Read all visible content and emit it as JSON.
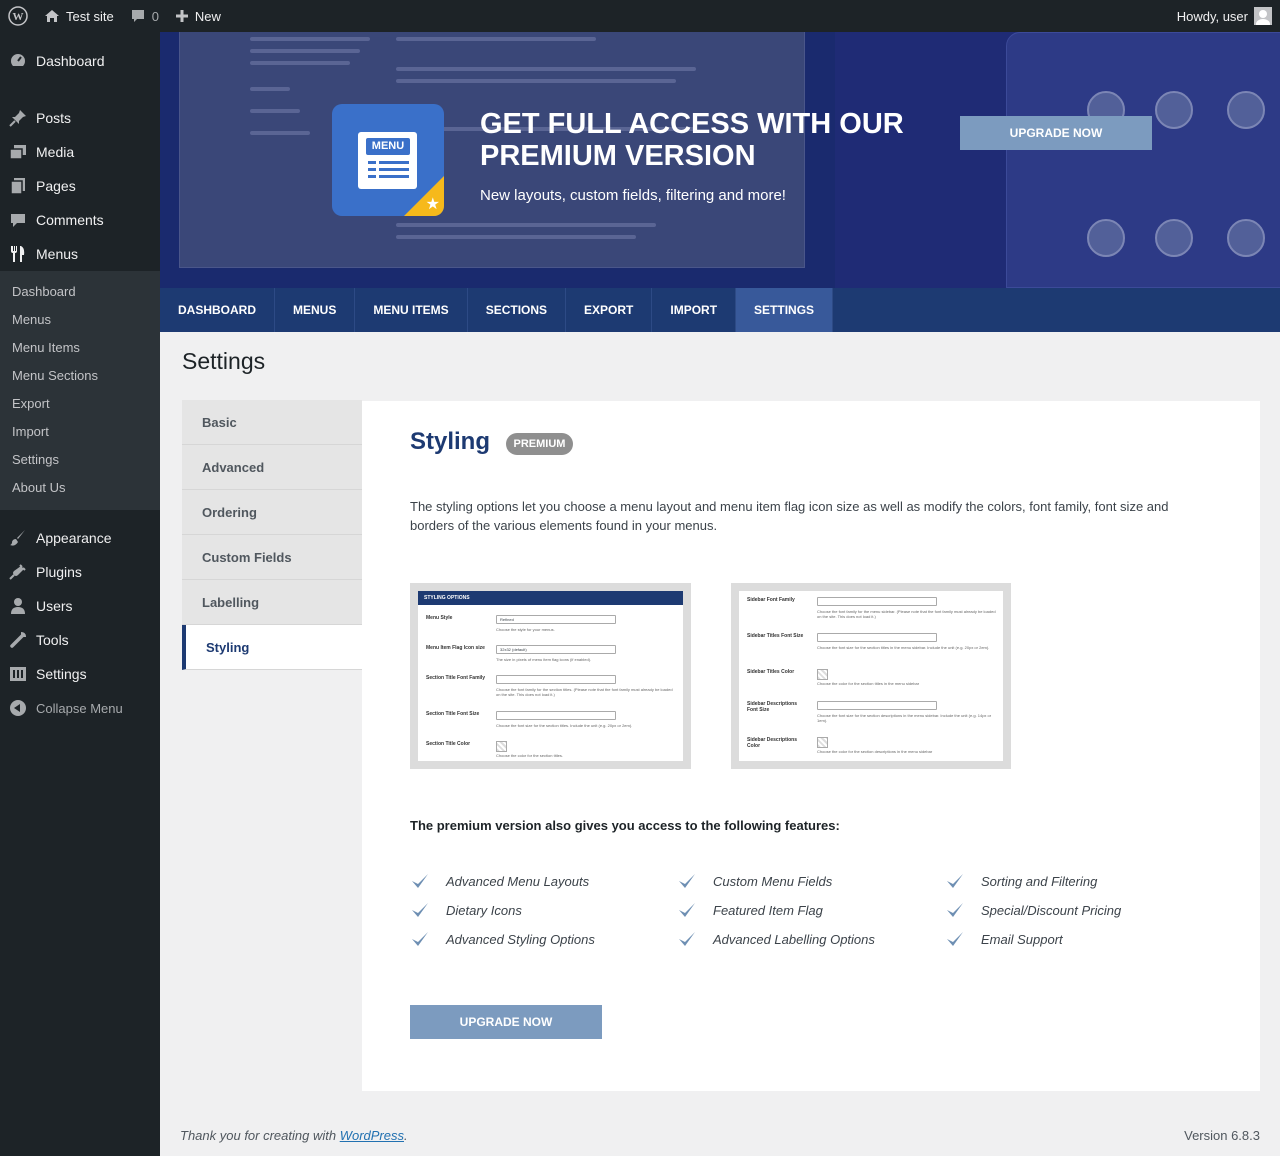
{
  "adminbar": {
    "site_name": "Test site",
    "comments_count": "0",
    "new_label": "New",
    "howdy": "Howdy, user"
  },
  "sidebar": {
    "top": [
      {
        "label": "Dashboard",
        "icon": "dashboard-icon"
      },
      {
        "label": "Posts",
        "icon": "pin-icon"
      },
      {
        "label": "Media",
        "icon": "media-icon"
      },
      {
        "label": "Pages",
        "icon": "pages-icon"
      },
      {
        "label": "Comments",
        "icon": "comment-icon"
      },
      {
        "label": "Menus",
        "icon": "fork-knife-icon"
      }
    ],
    "submenu": [
      "Dashboard",
      "Menus",
      "Menu Items",
      "Menu Sections",
      "Export",
      "Import",
      "Settings",
      "About Us"
    ],
    "bottom": [
      {
        "label": "Appearance",
        "icon": "brush-icon"
      },
      {
        "label": "Plugins",
        "icon": "plug-icon"
      },
      {
        "label": "Users",
        "icon": "user-icon"
      },
      {
        "label": "Tools",
        "icon": "wrench-icon"
      },
      {
        "label": "Settings",
        "icon": "settings-icon"
      }
    ],
    "collapse": "Collapse Menu"
  },
  "banner": {
    "logo_text": "MENU",
    "title": "GET FULL ACCESS WITH OUR PREMIUM VERSION",
    "subtitle": "New layouts, custom fields, filtering and more!",
    "button": "UPGRADE NOW"
  },
  "tabs": [
    "DASHBOARD",
    "MENUS",
    "MENU ITEMS",
    "SECTIONS",
    "EXPORT",
    "IMPORT",
    "SETTINGS"
  ],
  "active_tab": "SETTINGS",
  "page_title": "Settings",
  "settings_tabs": [
    "Basic",
    "Advanced",
    "Ordering",
    "Custom Fields",
    "Labelling",
    "Styling"
  ],
  "panel": {
    "title": "Styling",
    "badge": "PREMIUM",
    "description": "The styling options let you choose a menu layout and menu item flag icon size as well as modify the colors, font family, font size and borders of the various elements found in your menus.",
    "screenshot1": {
      "header": "STYLING OPTIONS",
      "rows": [
        {
          "label": "Menu Style",
          "value": "Refined",
          "help": "Choose the style for your menus."
        },
        {
          "label": "Menu Item Flag Icon size",
          "value": "32x32 (default)",
          "help": "The size in pixels of menu item flag icons (if enabled)."
        },
        {
          "label": "Section Title Font Family",
          "value": "",
          "help": "Choose the font family for the section titles. (Please note that the font family must already be loaded on the site. This does not load it.)"
        },
        {
          "label": "Section Title Font Size",
          "value": "",
          "help": "Choose the font size for the section titles. Include the unit (e.g. 20px or 2em)."
        },
        {
          "label": "Section Title Color",
          "value": "",
          "help": "Choose the color for the section titles."
        }
      ]
    },
    "screenshot2": {
      "rows": [
        {
          "label": "Sidebar Font Family",
          "help": "Choose the font family for the menu sidebar. (Please note that the font family must already be loaded on the site. This does not load it.)"
        },
        {
          "label": "Sidebar Titles Font Size",
          "help": "Choose the font size for the section titles in the menu sidebar. Include the unit (e.g. 20px or 2em)."
        },
        {
          "label": "Sidebar Titles Color",
          "help": "Choose the color for the section titles in the menu sidebar"
        },
        {
          "label": "Sidebar Descriptions Font Size",
          "help": "Choose the font size for the section descriptions in the menu sidebar. Include the unit (e.g. 14px or 1em)."
        },
        {
          "label": "Sidebar Descriptions Color",
          "help": "Choose the color for the section descriptions in the menu sidebar"
        }
      ]
    },
    "features_title": "The premium version also gives you access to the following features:",
    "features": [
      "Advanced Menu Layouts",
      "Custom Menu Fields",
      "Sorting and Filtering",
      "Dietary Icons",
      "Featured Item Flag",
      "Special/Discount Pricing",
      "Advanced Styling Options",
      "Advanced Labelling Options",
      "Email Support"
    ],
    "button": "UPGRADE NOW"
  },
  "footer": {
    "thanks_prefix": "Thank you for creating with ",
    "wp_link": "WordPress",
    "thanks_suffix": ".",
    "version": "Version 6.8.3"
  },
  "colors": {
    "admin_dark": "#1d2327",
    "brand_navy": "#1d3a72",
    "button_blue": "#7c9bbf",
    "badge_gray": "#8f8f8f"
  }
}
